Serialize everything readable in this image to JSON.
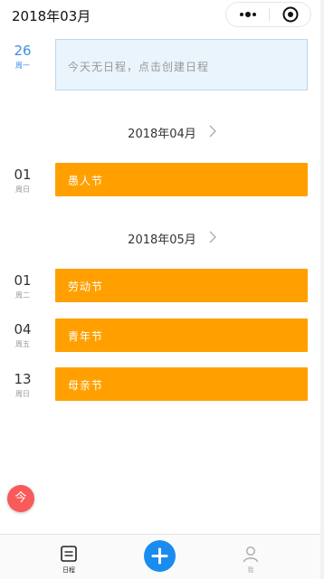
{
  "header": {
    "title": "2018年03月",
    "more_icon": "more-dots-icon",
    "close_icon": "target-circle-icon"
  },
  "today": {
    "day": "26",
    "weekday": "周一",
    "empty_message": "今天无日程，点击创建日程"
  },
  "months": [
    {
      "label": "2018年04月",
      "events": [
        {
          "day": "01",
          "weekday": "周日",
          "title": "愚人节"
        }
      ]
    },
    {
      "label": "2018年05月",
      "events": [
        {
          "day": "01",
          "weekday": "周二",
          "title": "劳动节"
        },
        {
          "day": "04",
          "weekday": "周五",
          "title": "青年节"
        },
        {
          "day": "13",
          "weekday": "周日",
          "title": "母亲节"
        }
      ]
    }
  ],
  "today_button": "今",
  "tabbar": {
    "calendar_label": "日程",
    "me_label": "我",
    "add_icon": "plus-icon"
  },
  "colors": {
    "event": "#ffa000",
    "today_text": "#3c8ee6",
    "empty_card": "#eaf4fc",
    "today_button": "#f95a5a",
    "add_button": "#1a8cf0"
  }
}
